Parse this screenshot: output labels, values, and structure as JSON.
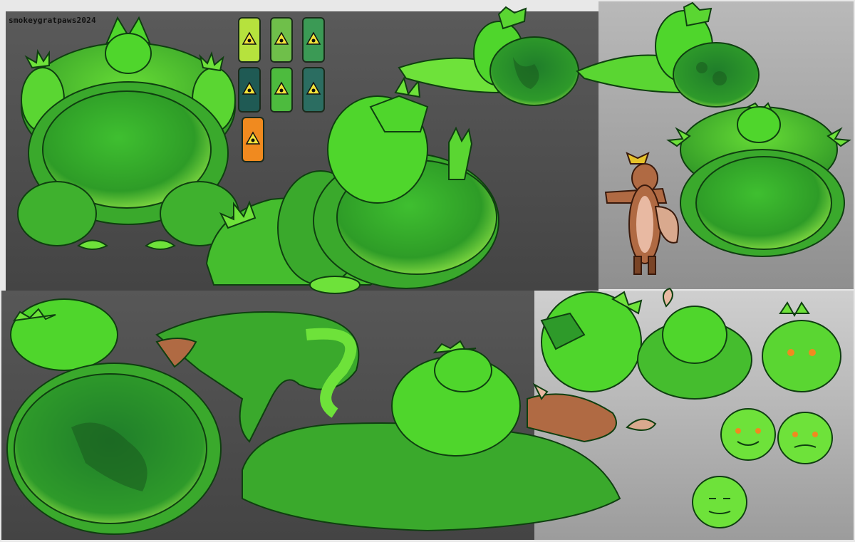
{
  "signature": "smokeygratpaws2024",
  "palette": {
    "slime_light": "#a6f044",
    "slime_mid": "#4fd62c",
    "slime_dark": "#1f7a1a",
    "belly_core": "#2f9f2a",
    "outline": "#0f3f10",
    "fox_fur": "#b06a43",
    "fox_belly": "#e8b9a2",
    "barrel_orange": "#f08a1f",
    "barrel_teal": "#1f5a54",
    "hazard_yellow": "#f2e33a"
  },
  "barrels": [
    {
      "color": "#b6e23d",
      "icon": "biohazard-icon"
    },
    {
      "color": "#6fbf4a",
      "icon": "biohazard-icon"
    },
    {
      "color": "#3b9a55",
      "icon": "biohazard-icon"
    },
    {
      "color": "#1f5a54",
      "icon": "biohazard-icon"
    },
    {
      "color": "#4dbb3e",
      "icon": "biohazard-icon"
    },
    {
      "color": "#2b6d61",
      "icon": "biohazard-icon"
    },
    {
      "color": "#f08a1f",
      "icon": "biohazard-icon"
    }
  ]
}
